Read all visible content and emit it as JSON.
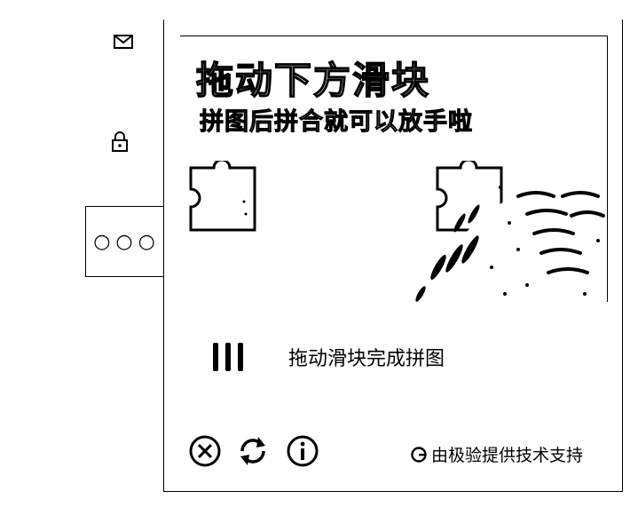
{
  "sidebar": {
    "icons": [
      "mail-icon",
      "lock-icon"
    ],
    "more_label": "○○○"
  },
  "captcha": {
    "title": "拖动下方滑块",
    "subtitle": "拼图后拼合就可以放手啦",
    "slider_hint": "拖动滑块完成拼图",
    "footer": {
      "close_icon": "close-circle-icon",
      "refresh_icon": "refresh-icon",
      "info_icon": "info-circle-icon",
      "credit_text": "由极验提供技术支持",
      "credit_logo": "geetest-logo-icon"
    }
  }
}
